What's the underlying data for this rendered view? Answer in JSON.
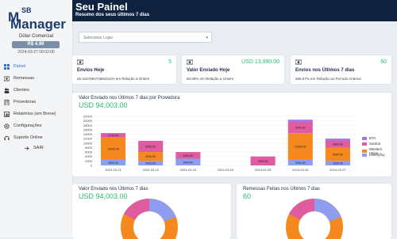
{
  "brand": {
    "prefix": "M",
    "sup": "SB",
    "line2": "Manager"
  },
  "rate": {
    "title": "Dólar Comercial",
    "value": "R$ 4.99",
    "date": "2024-03-27 09:02:00"
  },
  "nav": [
    {
      "label": "Painel",
      "icon": "grid-icon"
    },
    {
      "label": "Remessas",
      "icon": "money-icon"
    },
    {
      "label": "Clientes",
      "icon": "users-icon"
    },
    {
      "label": "Provedoras",
      "icon": "building-icon"
    },
    {
      "label": "Relatórios (em Breve)",
      "icon": "report-icon"
    },
    {
      "label": "Configurações",
      "icon": "gear-icon"
    },
    {
      "label": "Suporte Online",
      "icon": "support-icon"
    },
    {
      "label": "SAIR",
      "icon": "logout-icon"
    }
  ],
  "header": {
    "title": "Seu Painel",
    "subtitle": "Resumo dos seus últimos 7 dias"
  },
  "store_select": {
    "placeholder": "Selecionar Lojas"
  },
  "stats": [
    {
      "icon": "money-icon",
      "value": "5",
      "label": "Envios Hoje",
      "note": "26.315789473684211% em Relação a Ontem"
    },
    {
      "icon": "money-icon",
      "value": "USD 13,990.00",
      "label": "Valor Enviado Hoje",
      "note": "60.99% em Relação a Ontem"
    },
    {
      "icon": "money-icon",
      "value": "60",
      "label": "Envios nos Últimos 7 dias",
      "note": "666.67% em Relação ao Período Anterior"
    }
  ],
  "providers_chart": {
    "title": "Valor Enviado nos Últimos 7 dias por Provedora",
    "total": "USD 94,003.00"
  },
  "colors": {
    "BTA": "#a774e8",
    "Sanbor": "#e05ca0",
    "Western Union": "#f5891f",
    "Libertyfoy": "#8f9df0"
  },
  "chart_data": {
    "type": "bar",
    "stacked": true,
    "categories": [
      "2024-03-21",
      "2024-03-22",
      "2024-03-23",
      "2024-03-24",
      "2024-03-25",
      "2024-03-26",
      "2024-03-27"
    ],
    "series": [
      {
        "name": "Libertyfoy",
        "values": [
          2500,
          2000,
          3000,
          0,
          0,
          2500,
          2000
        ],
        "labels": [
          "2500.00",
          "2000.00",
          "3000.00",
          "",
          "",
          "2500.00",
          "2000.00"
        ]
      },
      {
        "name": "Western Union",
        "values": [
          10000,
          4000,
          0,
          0,
          0,
          12000,
          6000
        ],
        "labels": [
          "10000.00",
          "4000.00",
          "",
          "",
          "",
          "12000.00",
          "6000.00"
        ]
      },
      {
        "name": "Sanbor",
        "values": [
          2000,
          5000,
          3000,
          0,
          4000,
          5000,
          3000
        ],
        "labels": [
          "2778.00",
          "5000.00",
          "3000.00",
          "",
          "4000.00",
          "5000.00",
          "3000.00"
        ]
      },
      {
        "name": "BTA",
        "values": [
          0,
          0,
          0,
          0,
          0,
          1000,
          1000
        ],
        "labels": [
          "",
          "",
          "",
          "",
          "",
          "",
          ""
        ]
      }
    ],
    "yticks": [
      0,
      2000,
      4000,
      6000,
      8000,
      10000,
      12000,
      14000,
      16000,
      18000,
      20000,
      22000
    ],
    "ylim": [
      0,
      22000
    ],
    "legend_position": "right"
  },
  "bottom_left": {
    "title": "Valor Enviado nos Últimos 7 dias",
    "total": "USD 94,003.00"
  },
  "bottom_right": {
    "title": "Remessas Feitas nos Últimos 7 dias",
    "total": "60"
  }
}
